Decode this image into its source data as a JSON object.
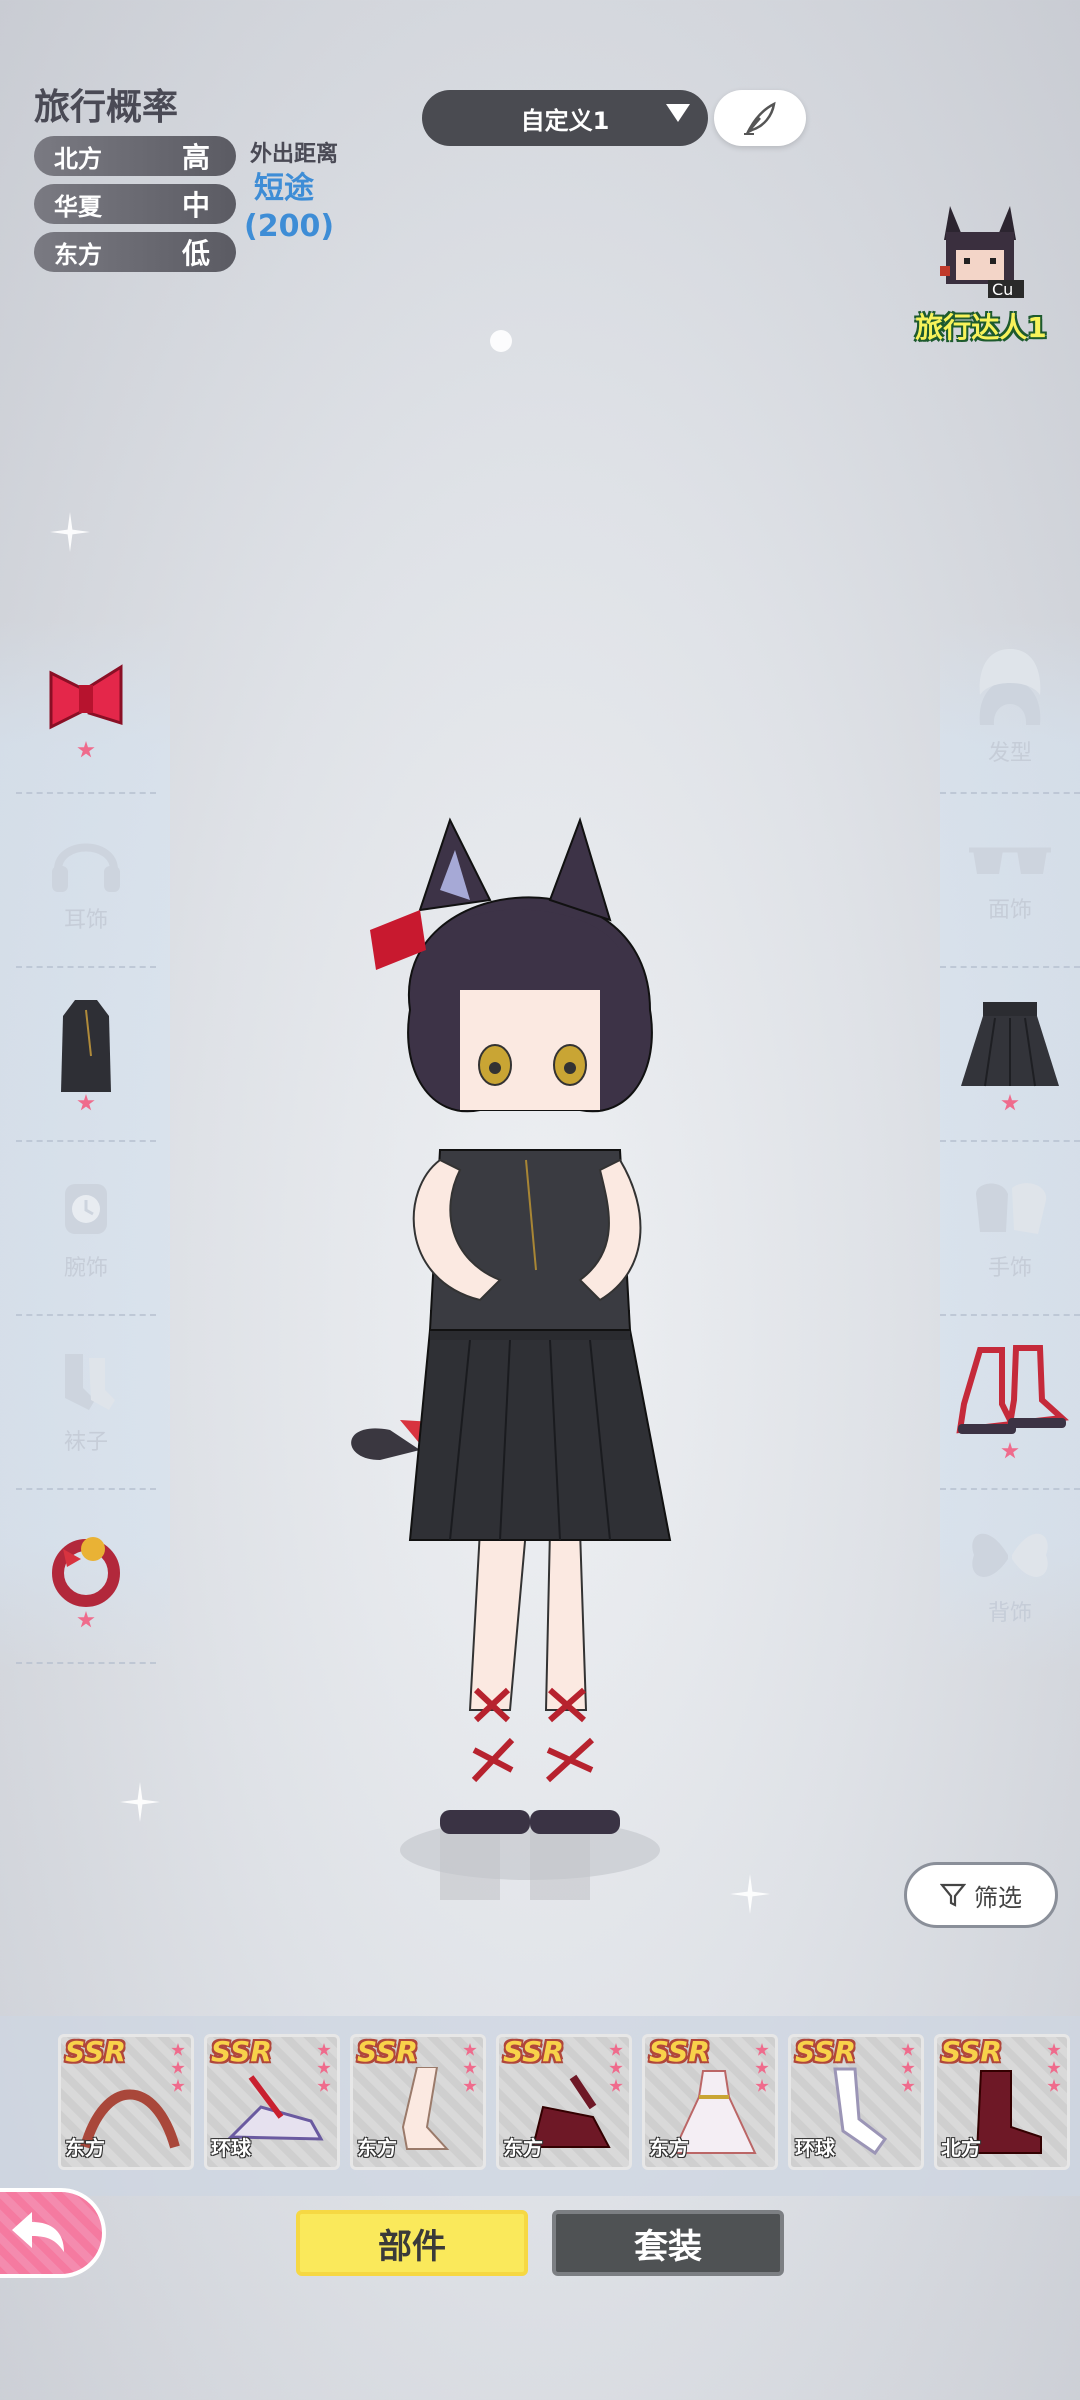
{
  "travel": {
    "title": "旅行概率",
    "regions": [
      {
        "name": "北方",
        "level": "高"
      },
      {
        "name": "华夏",
        "level": "中"
      },
      {
        "name": "东方",
        "level": "低"
      }
    ],
    "distance_label": "外出距离",
    "distance_value": "短途",
    "distance_number": "(200)"
  },
  "preset": {
    "label": "自定义1"
  },
  "achievement": {
    "label": "旅行达人1"
  },
  "left_categories": [
    {
      "name": "头饰",
      "label": "",
      "equipped": true
    },
    {
      "name": "耳饰",
      "label": "耳饰",
      "equipped": false
    },
    {
      "name": "上衣",
      "label": "",
      "equipped": true
    },
    {
      "name": "腕饰",
      "label": "腕饰",
      "equipped": false
    },
    {
      "name": "袜子",
      "label": "袜子",
      "equipped": false
    },
    {
      "name": "尾饰",
      "label": "",
      "equipped": true
    }
  ],
  "right_categories": [
    {
      "name": "发型",
      "label": "发型",
      "equipped": false
    },
    {
      "name": "面饰",
      "label": "面饰",
      "equipped": false
    },
    {
      "name": "下装",
      "label": "",
      "equipped": true
    },
    {
      "name": "手饰",
      "label": "手饰",
      "equipped": false
    },
    {
      "name": "鞋子",
      "label": "",
      "equipped": true
    },
    {
      "name": "背饰",
      "label": "背饰",
      "equipped": false
    }
  ],
  "filter": {
    "label": "筛选"
  },
  "items": [
    {
      "rarity": "SSR",
      "region": "东方",
      "icon": "hair-braid-icon"
    },
    {
      "rarity": "SSR",
      "region": "环球",
      "icon": "sneaker-icon"
    },
    {
      "rarity": "SSR",
      "region": "东方",
      "icon": "stocking-icon"
    },
    {
      "rarity": "SSR",
      "region": "东方",
      "icon": "heeled-shoe-icon"
    },
    {
      "rarity": "SSR",
      "region": "东方",
      "icon": "dress-icon"
    },
    {
      "rarity": "SSR",
      "region": "环球",
      "icon": "white-sock-icon"
    },
    {
      "rarity": "SSR",
      "region": "北方",
      "icon": "boot-icon"
    }
  ],
  "tabs": {
    "parts": "部件",
    "outfit": "套装"
  },
  "colors": {
    "accent_yellow": "#fae95b",
    "pink": "#ef6b8c",
    "dark": "#4a4b51",
    "blue_text": "#3e8dd6"
  }
}
